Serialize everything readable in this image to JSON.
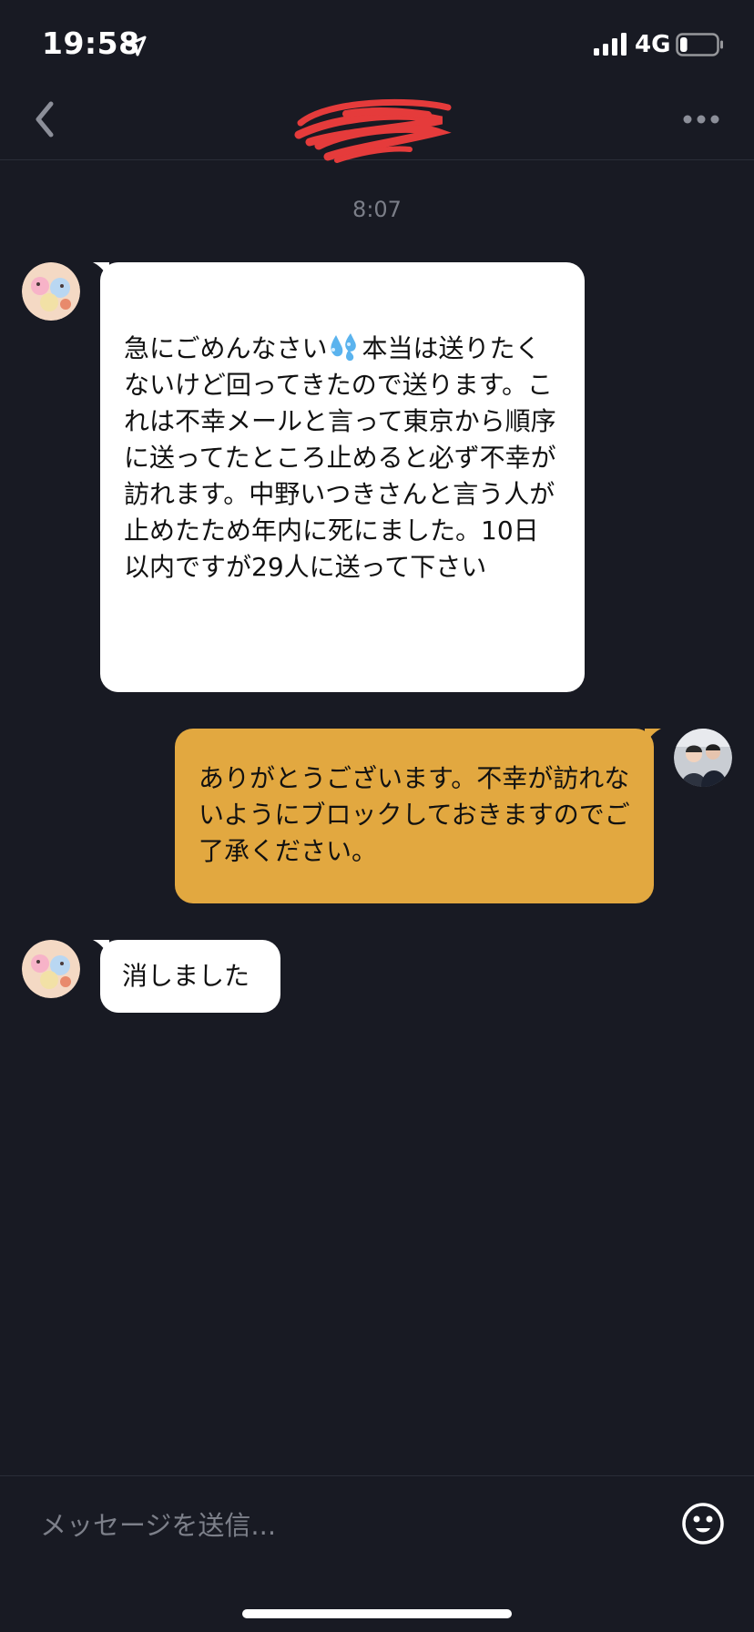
{
  "status_bar": {
    "time": "19:58",
    "network": "4G",
    "battery_level": 0.2
  },
  "header": {
    "back_icon": "chevron-left-icon",
    "title_redacted": true,
    "more_icon": "ellipsis-icon"
  },
  "chat": {
    "timestamp": "8:07",
    "messages": [
      {
        "direction": "incoming",
        "text_before_emoji": "急にごめんなさい",
        "emoji": "sweat-droplets-emoji",
        "text_after_emoji": "本当は送りたくないけど回ってきたので送ります。これは不幸メールと言って東京から順序に送ってたところ止めると必ず不幸が訪れます。中野いつきさんと言う人が止めたため年内に死にました。10日以内ですが29人に送って下さい"
      },
      {
        "direction": "outgoing",
        "text": "ありがとうございます。不幸が訪れないようにブロックしておきますのでご了承ください。"
      },
      {
        "direction": "incoming",
        "text": "消しました"
      }
    ]
  },
  "composer": {
    "placeholder": "メッセージを送信...",
    "emoji_icon": "smiley-icon"
  },
  "colors": {
    "background": "#181a23",
    "incoming_bubble": "#ffffff",
    "outgoing_bubble": "#e2a840",
    "redaction_scribble": "#e53b3b"
  }
}
